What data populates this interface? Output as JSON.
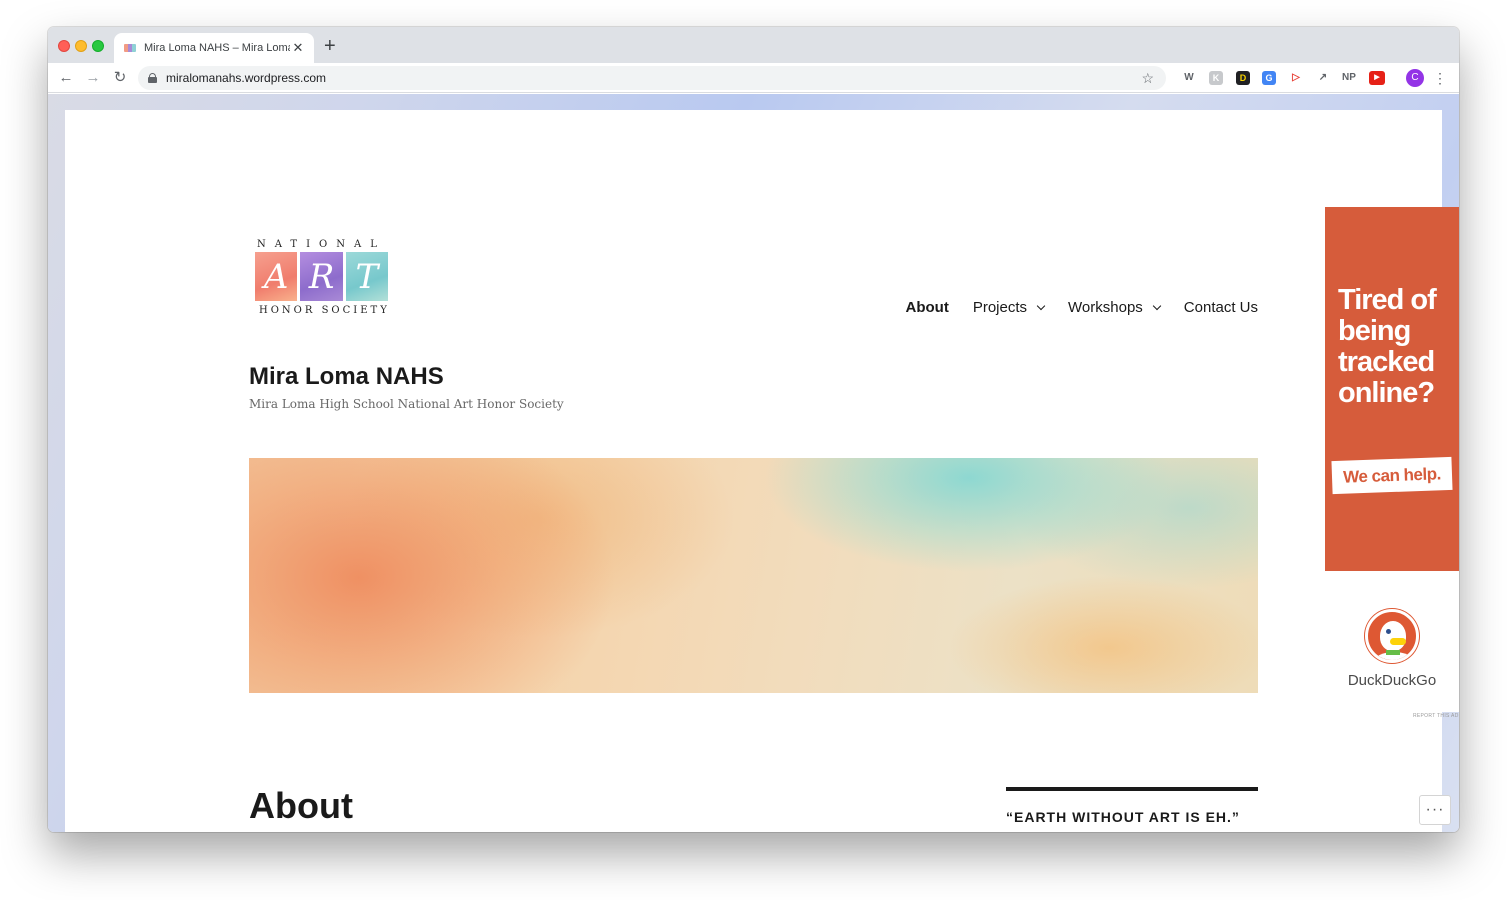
{
  "browser": {
    "tab": {
      "title": "Mira Loma NAHS – Mira Loma High School National Art Honor Society",
      "close": "✕"
    },
    "new_tab": "+",
    "nav": {
      "back": "←",
      "forward": "→",
      "reload": "↻"
    },
    "url": "miralomanahs.wordpress.com",
    "bookmark": "☆",
    "extensions": [
      {
        "label": "W",
        "name": "wikipedia-extension-icon"
      },
      {
        "label": "K",
        "name": "k-extension-icon"
      },
      {
        "label": "D",
        "name": "d-extension-icon"
      },
      {
        "label": "G",
        "name": "translate-extension-icon"
      },
      {
        "label": "▷",
        "name": "send-extension-icon"
      },
      {
        "label": "↗",
        "name": "share-extension-icon"
      },
      {
        "label": "NP",
        "name": "np-extension-icon"
      },
      {
        "label": "▶",
        "name": "youtube-extension-icon"
      }
    ],
    "profile_initial": "C",
    "menu": "⋮"
  },
  "site": {
    "logo": {
      "top": "NATIONAL",
      "blocks": [
        "A",
        "R",
        "T"
      ],
      "bottom": "HONOR SOCIETY"
    },
    "title": "Mira Loma NAHS",
    "description": "Mira Loma High School National Art Honor Society",
    "nav": [
      {
        "label": "About",
        "current": true,
        "dropdown": false
      },
      {
        "label": "Projects",
        "current": false,
        "dropdown": true
      },
      {
        "label": "Workshops",
        "current": false,
        "dropdown": true
      },
      {
        "label": "Contact Us",
        "current": false,
        "dropdown": false
      }
    ],
    "entry_title": "About",
    "widget_title": "“EARTH WITHOUT ART IS EH.”",
    "more_button": "···"
  },
  "ad": {
    "headline": "Tired of being tracked online?",
    "cta": "We can help.",
    "brand": "DuckDuckGo",
    "report": "REPORT THIS AD",
    "colors": {
      "background": "#d65c3b",
      "brand": "#de5833"
    }
  }
}
